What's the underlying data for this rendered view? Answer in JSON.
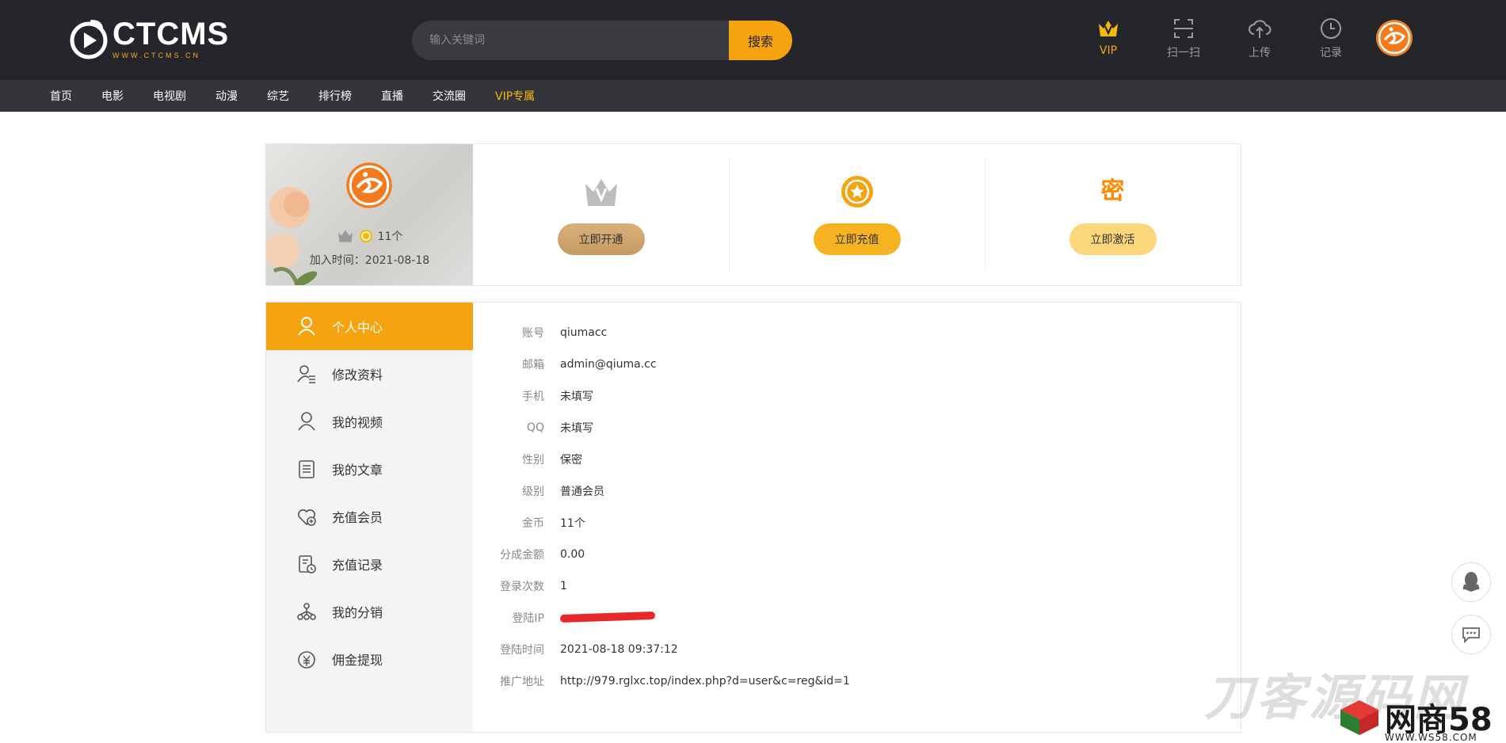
{
  "header": {
    "logo_title": "CTCMS",
    "logo_sub": "WWW.CTCMS.CN",
    "search_placeholder": "输入关键词",
    "search_button": "搜索",
    "vip_label": "VIP",
    "scan_label": "扫一扫",
    "upload_label": "上传",
    "history_label": "记录"
  },
  "nav": {
    "items": [
      "首页",
      "电影",
      "电视剧",
      "动漫",
      "综艺",
      "排行榜",
      "直播",
      "交流圈"
    ],
    "vip_item": "VIP专属"
  },
  "profile": {
    "coins": "11个",
    "joined": "加入时间：2021-08-18"
  },
  "actions": {
    "open_vip": "立即开通",
    "recharge": "立即充值",
    "activate_glyph": "密",
    "activate": "立即激活"
  },
  "sidebar": {
    "items": [
      {
        "label": "个人中心",
        "icon": "user-icon"
      },
      {
        "label": "修改资料",
        "icon": "user-edit-icon"
      },
      {
        "label": "我的视频",
        "icon": "user-icon"
      },
      {
        "label": "我的文章",
        "icon": "document-icon"
      },
      {
        "label": "充值会员",
        "icon": "heart-plus-icon"
      },
      {
        "label": "充值记录",
        "icon": "receipt-icon"
      },
      {
        "label": "我的分销",
        "icon": "network-icon"
      },
      {
        "label": "佣金提现",
        "icon": "money-bag-icon"
      }
    ]
  },
  "account": {
    "rows": [
      {
        "label": "账号",
        "value": "qiumacc"
      },
      {
        "label": "邮箱",
        "value": "admin@qiuma.cc"
      },
      {
        "label": "手机",
        "value": "未填写"
      },
      {
        "label": "QQ",
        "value": "未填写"
      },
      {
        "label": "性别",
        "value": "保密"
      },
      {
        "label": "级别",
        "value": "普通会员"
      },
      {
        "label": "金币",
        "value": "11个"
      },
      {
        "label": "分成金额",
        "value": "0.00"
      },
      {
        "label": "登录次数",
        "value": "1"
      },
      {
        "label": "登陆IP",
        "value": ""
      },
      {
        "label": "登陆时间",
        "value": "2021-08-18 09:37:12"
      },
      {
        "label": "推广地址",
        "value": "http://979.rglxc.top/index.php?d=user&c=reg&id=1"
      }
    ]
  },
  "watermark": {
    "text1": "刀客源码网",
    "text2": "网商58",
    "text2_sub": "WWW.WS58.COM"
  },
  "colors": {
    "accent": "#f5a30e",
    "header_bg": "#25262b",
    "nav_bg": "#33353b"
  }
}
